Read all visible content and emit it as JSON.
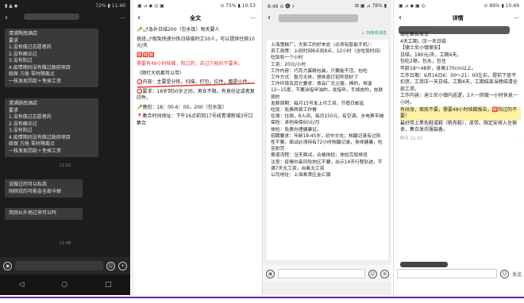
{
  "panel1": {
    "status_right": "72% ▮ 11:40",
    "status_left": "▮ ▲ ◆",
    "back": "‹",
    "more": "···",
    "msg1_lines": [
      "清浦陶南酒店",
      "要求",
      "1.没有做过志愿者的",
      "2.没有确诊过",
      "3.没有阳过",
      "4.疫情期间没有做过政府项目",
      "临保 方舱 零时隔离点",
      "一枝发现罚款＋免掉工资"
    ],
    "msg2_lines": [
      "清浦顾南酒店",
      "要求",
      "1.没有做过志愿者的",
      "2.没有确诊过",
      "3.没有阳过",
      "4.疫情期间没有做过政府项目",
      "临保 方舱 零时隔离点",
      "一枝发现罚款＋免掉工资"
    ],
    "time1": "11:02",
    "msg3_lines": [
      "没做过的可以私我",
      "刚刚说的可能会全部卡掉"
    ],
    "msg4": "我刚从外地过来可以吗",
    "time2": "11:08",
    "nav_back": "◁",
    "nav_home": "○",
    "nav_recent": "□"
  },
  "panel2": {
    "status_left": "▣ ⊿ ◆ ◎ ▣",
    "status_right": "⊙ 75% ▮ 10:53",
    "title": "全文",
    "back": "‹",
    "more": "···",
    "para1": "🥕🌶急补日结200（包水饭）每天要人",
    "para2": "夜班🌶极兔快递分拣日结临时工50人，可以提供住宿10元/天",
    "para2_red": "🈲🈲🈲",
    "para3_red": "需要有48小时核酸，阳过的，去过方舱的不要来。",
    "para4": "（顺打大机都可以带）",
    "para5": "⭕内容：主要是分拣，扫描，打包，拉件，都是小件。",
    "para6": "⭕要求：18岁到50岁之间，男女不限，有身份证或者复印件。",
    "para7": "🥕晚班：18：00-6：00，200（包水饭）",
    "para8": "📍集合时间地址：下午16点前到17号线青浦新城3号口集合"
  },
  "panel3": {
    "status_left": "8:49 ⊙ 🅐 ⚡",
    "status_right": "⊞ ▣ ⊿ 78% ▮",
    "back": "‹",
    "new_msgs": "↓ 39条新消息",
    "lines": [
      "上海雪糕厂，大新工的好去处（必须有智能手机）：",
      "员工政策：上班时间8点到8点，12小时（含吃饭时间）吃饭和一个小时",
      "工资：20元/小时",
      "工作内容：巧克力蛋糕包装，只要能干活，包吃",
      "工作方式：暂月无休，想休息打招呼就好了",
      "工作环境及其它要求：食品厂无尘服，棉的，恒温12~15度，不要涂指甲油的，发指甲，手掉皮的，皮肤病的",
      "发薪周期：每月15号发上月工资，节假日邮延",
      "吃饭：免费两顿工作餐",
      "住宿：住宿，8人间，每月150元，有空调，水电费平摊",
      "保险：承担商保60元/月",
      "体检：免费办理健康证。",
      "招聘要求：年龄18-45岁，初中文化；核酸记录有过阳性不要，面试必须持有72小时核酸记录，身体健康，吃苦耐劳",
      "报道流程：当天面试，合格体检，体检完就排班",
      "注意：疫情中高风险地区不要，出示14天行程轨迹，不满7天无工资，自离无工资",
      "公司地址：上海奉贤区金汇镇"
    ],
    "voice": "◉",
    "emoji": "☺",
    "plus": "⊕"
  },
  "panel4": {
    "status_left": "▣ ⊿ ◆ ▣ ◎",
    "status_right": "⊙ 89% ▮ 10:49",
    "title": "详情",
    "back": "‹",
    "more": "···",
    "lines": [
      "现在集合发车",
      "4天工期，压一天日结",
      "【德士尼小镇保安】",
      "日结，180元/天，工期4天。",
      "包吃2顿，包水，包住",
      "年龄18～48岁，身高170cm以上。",
      "工作日期：6月16日6：00～21：00左右，提前下班不扣资，工资压一天日结，工期4天，工期结束当晚结清全部工资。",
      "工作内容：迪士尼小镇内巡逻，2人一岗做一小时休息一小时。"
    ],
    "hl_line": "有纹身，案底不要，需要48小时核酸报告，🈲阳过的不要！",
    "tail_line": "最好带上黑色鞋或鞋（帆布鞋），皮带。限定安排入住宿舍，集合发衣服装备。",
    "date": "昨天 21:01",
    "dots": "··",
    "emoji": "☺",
    "send": "发送"
  }
}
